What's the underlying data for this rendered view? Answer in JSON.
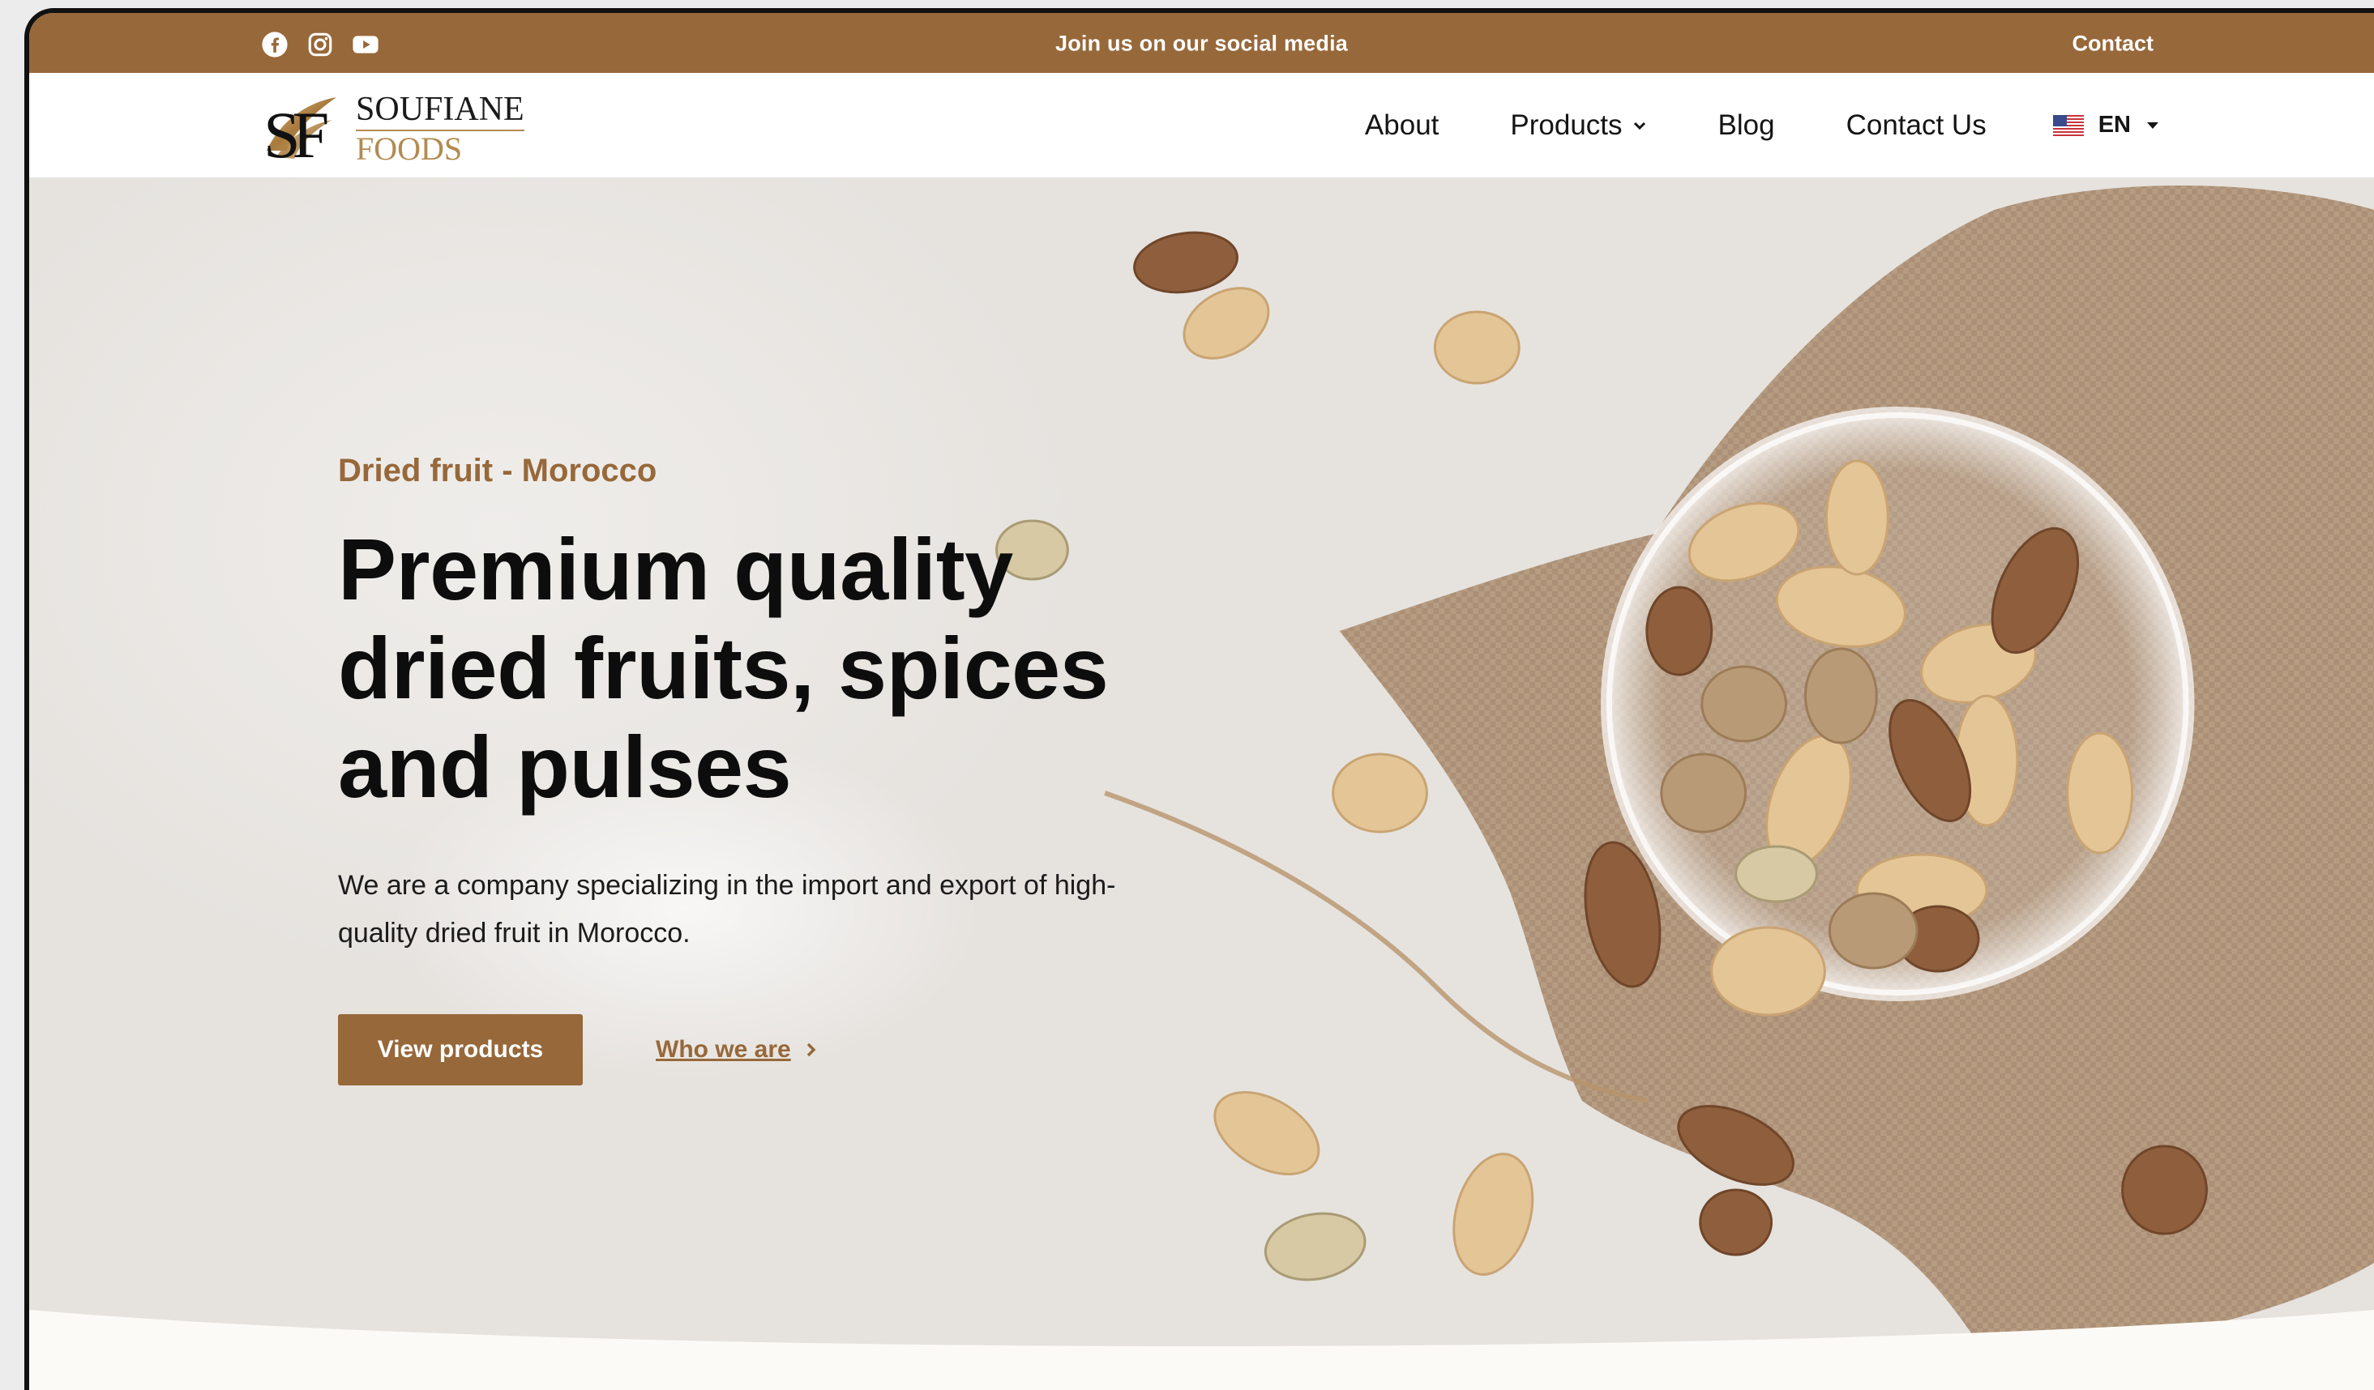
{
  "topbar": {
    "social_icons": [
      "facebook-icon",
      "instagram-icon",
      "youtube-icon"
    ],
    "message": "Join us on our social media",
    "contact_label": "Contact",
    "background": "#97683a"
  },
  "brand": {
    "logo_initials": "SF",
    "name_line1": "SOUFIANE",
    "name_line2": "FOODS",
    "gold": "#b38b4f"
  },
  "nav": {
    "items": [
      {
        "label": "About"
      },
      {
        "label": "Products",
        "has_dropdown": true
      },
      {
        "label": "Blog"
      },
      {
        "label": "Contact Us"
      }
    ],
    "language": {
      "code": "EN",
      "flag_icon": "us-flag-icon"
    }
  },
  "hero": {
    "eyebrow": "Dried fruit - Morocco",
    "headline": "Premium quality dried fruits, spices and pulses",
    "description": "We are a company specializing in the import and export of high-quality dried fruit in Morocco.",
    "primary_button": "View products",
    "secondary_link": "Who we are",
    "accent": "#97683a"
  }
}
